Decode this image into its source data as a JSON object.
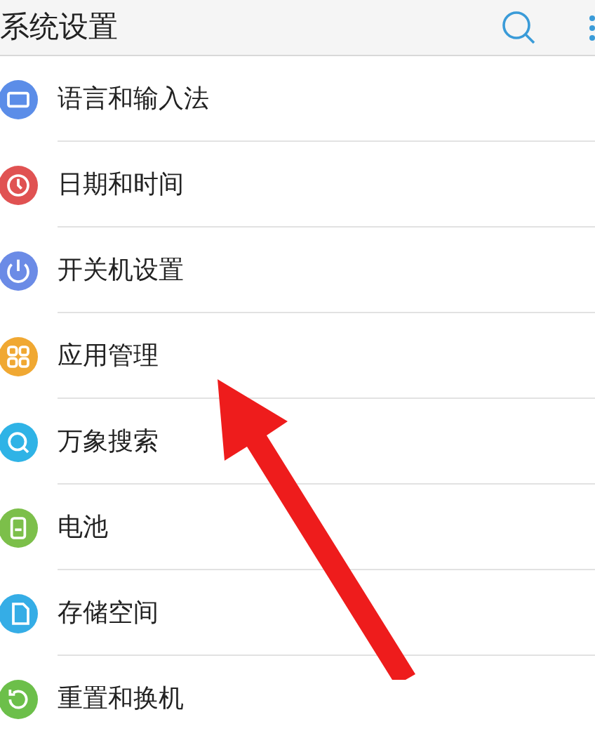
{
  "header": {
    "title": "系统设置"
  },
  "items": [
    {
      "label": "语言和输入法",
      "kind": "keyboard",
      "color": "#5b8de8"
    },
    {
      "label": "日期和时间",
      "kind": "clock",
      "color": "#e05252"
    },
    {
      "label": "开关机设置",
      "kind": "power",
      "color": "#6b8be6"
    },
    {
      "label": "应用管理",
      "kind": "apps",
      "color": "#f0a832"
    },
    {
      "label": "万象搜索",
      "kind": "search",
      "color": "#2fb3e6"
    },
    {
      "label": "电池",
      "kind": "battery",
      "color": "#7cbf4a"
    },
    {
      "label": "存储空间",
      "kind": "storage",
      "color": "#35ade6"
    },
    {
      "label": "重置和换机",
      "kind": "reset",
      "color": "#6cbf4a"
    }
  ]
}
